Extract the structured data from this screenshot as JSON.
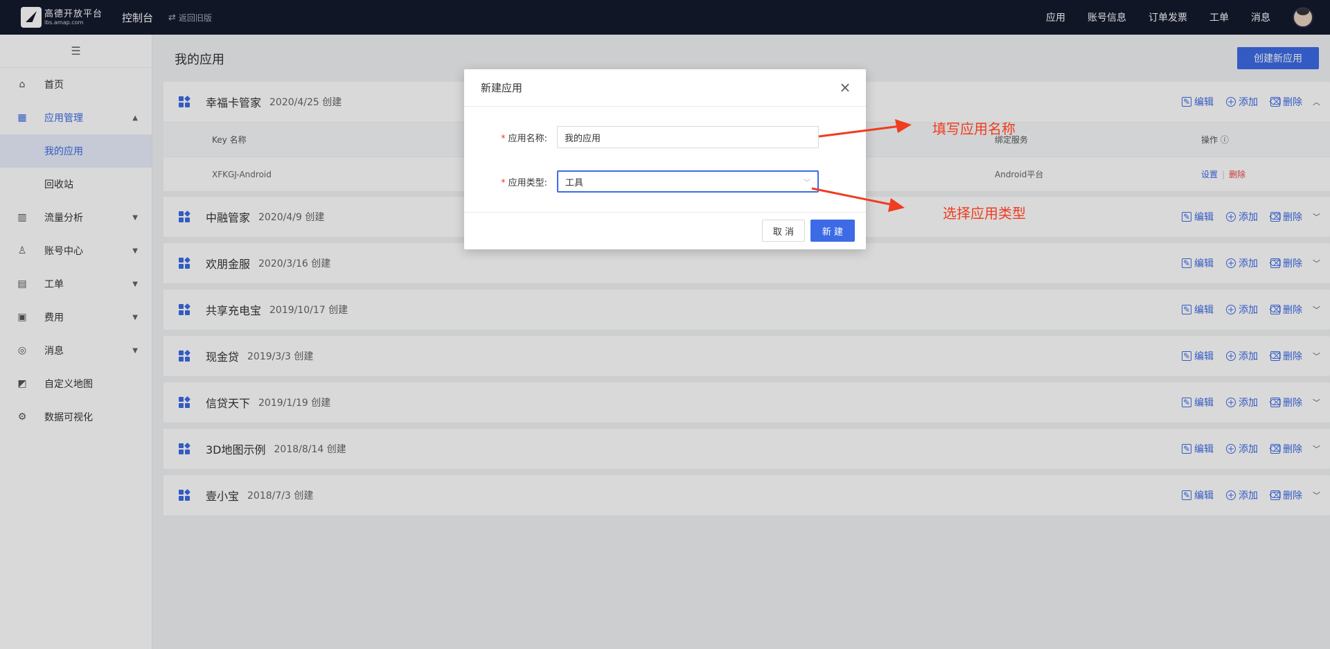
{
  "topbar": {
    "logo_main": "高德开放平台",
    "logo_sub": "lbs.amap.com",
    "console": "控制台",
    "back_old": "返回旧版",
    "nav": [
      "应用",
      "账号信息",
      "订单发票",
      "工单",
      "消息"
    ]
  },
  "sidebar": {
    "items": [
      {
        "label": "首页",
        "icon": "home-icon"
      },
      {
        "label": "应用管理",
        "icon": "grid-icon"
      },
      {
        "label": "我的应用"
      },
      {
        "label": "回收站"
      },
      {
        "label": "流量分析",
        "icon": "chart-icon"
      },
      {
        "label": "账号中心",
        "icon": "user-icon"
      },
      {
        "label": "工单",
        "icon": "ticket-icon"
      },
      {
        "label": "费用",
        "icon": "wallet-icon"
      },
      {
        "label": "消息",
        "icon": "message-icon"
      },
      {
        "label": "自定义地图",
        "icon": "map-icon"
      },
      {
        "label": "数据可视化",
        "icon": "dataviz-icon"
      }
    ]
  },
  "main": {
    "title": "我的应用",
    "create_btn": "创建新应用",
    "actions": {
      "edit": "编辑",
      "add": "添加",
      "delete": "删除"
    },
    "apps": [
      {
        "name": "幸福卡管家",
        "date": "2020/4/25 创建"
      },
      {
        "name": "中融管家",
        "date": "2020/4/9 创建"
      },
      {
        "name": "欢朋金服",
        "date": "2020/3/16 创建"
      },
      {
        "name": "共享充电宝",
        "date": "2019/10/17 创建"
      },
      {
        "name": "现金贷",
        "date": "2019/3/3 创建"
      },
      {
        "name": "信贷天下",
        "date": "2019/1/19 创建"
      },
      {
        "name": "3D地图示例",
        "date": "2018/8/14 创建"
      },
      {
        "name": "壹小宝",
        "date": "2018/7/3 创建"
      }
    ],
    "key_table": {
      "headers": [
        "Key 名称",
        "绑定服务",
        "操作"
      ],
      "rows": [
        {
          "key_name": "XFKGJ-Android",
          "service": "Android平台",
          "op_set": "设置",
          "op_del": "删除"
        }
      ]
    }
  },
  "modal": {
    "title": "新建应用",
    "name_label": "应用名称:",
    "name_value": "我的应用",
    "type_label": "应用类型:",
    "type_value": "工具",
    "cancel": "取 消",
    "ok": "新 建"
  },
  "annotations": {
    "fill_name": "填写应用名称",
    "choose_type": "选择应用类型",
    "color": "#f03c1f"
  },
  "colors": {
    "primary": "#3d6be5",
    "topbar": "#141a2e",
    "danger": "#ee4444"
  }
}
